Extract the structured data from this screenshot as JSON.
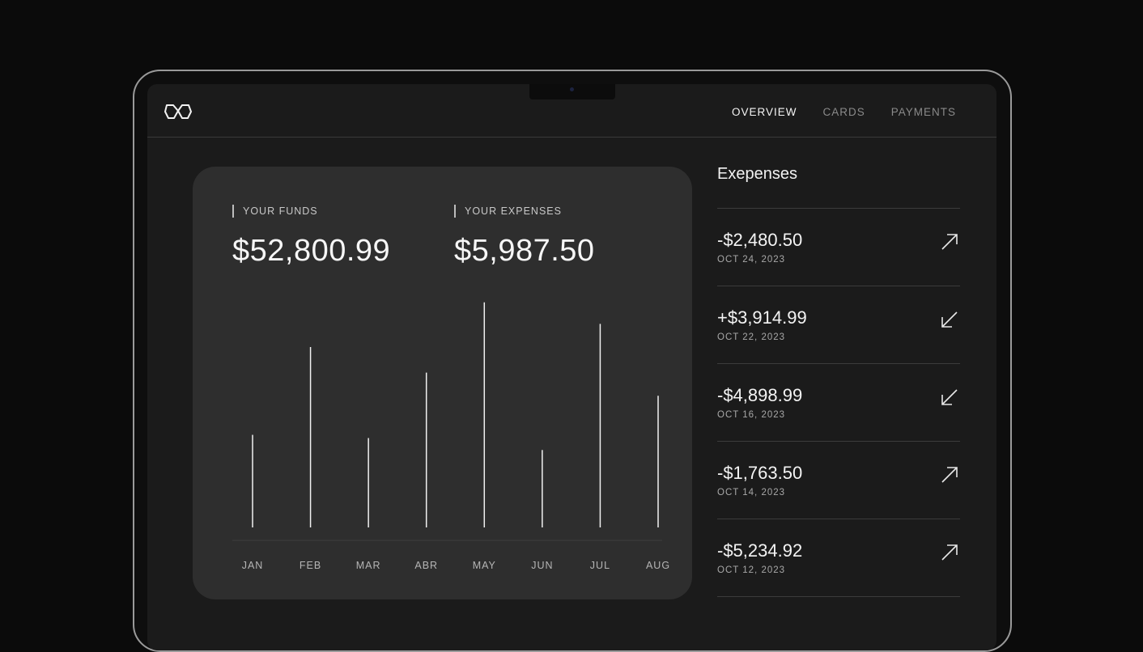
{
  "nav": {
    "items": [
      {
        "label": "OVERVIEW",
        "active": true
      },
      {
        "label": "CARDS",
        "active": false
      },
      {
        "label": "PAYMENTS",
        "active": false
      }
    ]
  },
  "stats": {
    "funds_label": "YOUR FUNDS",
    "funds_value": "$52,800.99",
    "expenses_label": "YOUR EXPENSES",
    "expenses_value": "$5,987.50"
  },
  "chart_data": {
    "type": "bar",
    "categories": [
      "JAN",
      "FEB",
      "MAR",
      "ABR",
      "MAY",
      "JUN",
      "JUL",
      "AUG"
    ],
    "values": [
      116,
      226,
      112,
      194,
      282,
      97,
      255,
      165
    ],
    "ylim": [
      0,
      300
    ],
    "grid": false
  },
  "expenses": {
    "title": "Exepenses",
    "items": [
      {
        "amount": "-$2,480.50",
        "date": "OCT 24, 2023",
        "direction": "up-right"
      },
      {
        "amount": "+$3,914.99",
        "date": "OCT 22, 2023",
        "direction": "down-left"
      },
      {
        "amount": "-$4,898.99",
        "date": "OCT 16, 2023",
        "direction": "down-left"
      },
      {
        "amount": "-$1,763.50",
        "date": "OCT 14, 2023",
        "direction": "up-right"
      },
      {
        "amount": "-$5,234.92",
        "date": "OCT 12, 2023",
        "direction": "up-right"
      }
    ]
  },
  "colors": {
    "background": "#0b0b0b",
    "screen": "#1b1b1b",
    "card": "#2e2e2e",
    "text": "#f2f2f2",
    "muted": "#8a8a8a"
  }
}
